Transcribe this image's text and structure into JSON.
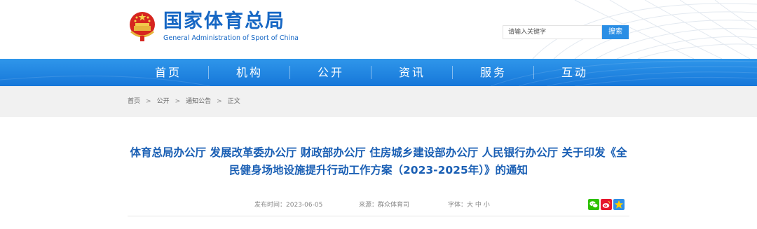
{
  "site": {
    "name_cn": "国家体育总局",
    "name_en": "General Administration of Sport of China"
  },
  "search": {
    "placeholder": "请输入关键字",
    "button_label": "搜索"
  },
  "nav": {
    "items": [
      "首页",
      "机构",
      "公开",
      "资讯",
      "服务",
      "互动"
    ]
  },
  "breadcrumb": {
    "items": [
      "首页",
      "公开",
      "通知公告",
      "正文"
    ],
    "separator": ">"
  },
  "article": {
    "title_line1": "体育总局办公厅 发展改革委办公厅 财政部办公厅 住房城乡建设部办公厅 人民银行办公厅 关于印发《全",
    "title_line2": "民健身场地设施提升行动工作方案（2023-2025年）》的通知",
    "published": "发布时间：2023-06-05",
    "source": "来源：群众体育司",
    "font_size_label": "字体：",
    "font_large": "大",
    "font_medium": "中",
    "font_small": "小"
  },
  "share": {
    "icons": [
      "wechat-icon",
      "weibo-icon",
      "qzone-icon"
    ]
  },
  "colors": {
    "brand_blue": "#1667c4",
    "nav_blue": "#1677d9",
    "title_blue": "#1a5fb4",
    "search_button": "#2a8ee5",
    "breadcrumb_bg": "#f1f1f1"
  }
}
